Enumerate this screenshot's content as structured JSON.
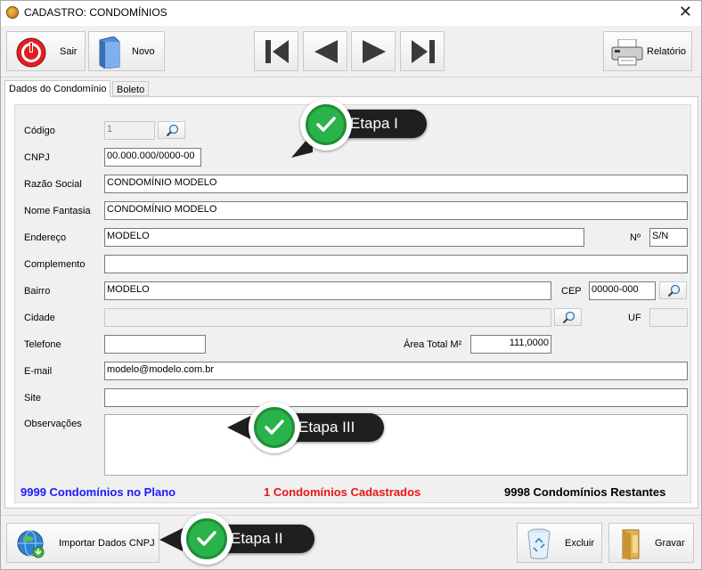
{
  "window": {
    "title": "CADASTRO: CONDOMÍNIOS",
    "close_glyph": "✕"
  },
  "toolbar": {
    "sair_label": "Sair",
    "novo_label": "Novo",
    "relatorio_label": "Relatório"
  },
  "tabs": [
    {
      "label": "Dados do Condomínio",
      "active": true
    },
    {
      "label": "Boleto",
      "active": false
    }
  ],
  "form": {
    "codigo": {
      "label": "Código",
      "value": "1"
    },
    "cnpj": {
      "label": "CNPJ",
      "value": "00.000.000/0000-00"
    },
    "razao_social": {
      "label": "Razão Social",
      "value": "CONDOMÍNIO MODELO"
    },
    "nome_fantasia": {
      "label": "Nome Fantasia",
      "value": "CONDOMÍNIO MODELO"
    },
    "endereco": {
      "label": "Endereço",
      "value": "MODELO"
    },
    "numero": {
      "label": "Nº",
      "value": "S/N"
    },
    "complemento": {
      "label": "Complemento",
      "value": ""
    },
    "bairro": {
      "label": "Bairro",
      "value": "MODELO"
    },
    "cep": {
      "label": "CEP",
      "value": "00000-000"
    },
    "cidade": {
      "label": "Cidade",
      "value": ""
    },
    "uf": {
      "label": "UF",
      "value": ""
    },
    "telefone": {
      "label": "Telefone",
      "value": ""
    },
    "area_total": {
      "label": "Área Total M²",
      "value": "111,0000"
    },
    "email": {
      "label": "E-mail",
      "value": "modelo@modelo.com.br"
    },
    "site": {
      "label": "Site",
      "value": ""
    },
    "observacoes": {
      "label": "Observações",
      "value": ""
    }
  },
  "stats": {
    "plano": "9999 Condomínios no Plano",
    "cadastrados": "1 Condomínios Cadastrados",
    "restantes": "9998 Condomínios Restantes",
    "plano_color": "#1a1aff",
    "cadastrados_color": "#e8141b",
    "restantes_color": "#000000"
  },
  "footer": {
    "importar_label": "Importar Dados CNPJ",
    "excluir_label": "Excluir",
    "gravar_label": "Gravar"
  },
  "callouts": {
    "etapa1": "Etapa I",
    "etapa2": "Etapa II",
    "etapa3": "Etapa III",
    "badge_icon": "check-icon",
    "badge_color": "#29b34a"
  }
}
